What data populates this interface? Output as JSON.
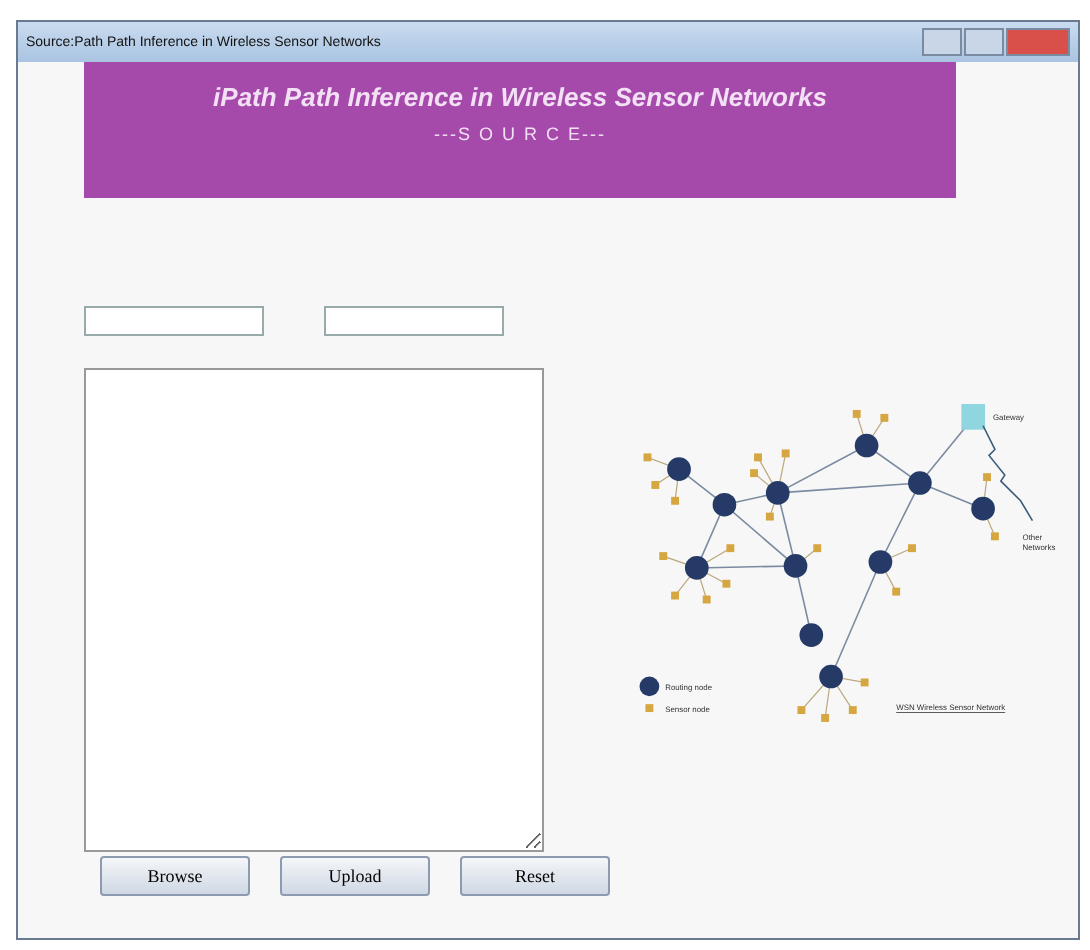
{
  "window": {
    "title": "Source:Path Path Inference in Wireless Sensor Networks"
  },
  "banner": {
    "title": "iPath Path Inference in Wireless Sensor Networks",
    "subtitle": "---S O U R C E---"
  },
  "diagram": {
    "gateway_label": "Gateway",
    "other_label": "Other Networks",
    "legend": [
      "Routing node",
      "Sensor node"
    ],
    "caption": "WSN Wireless Sensor Network"
  },
  "buttons": [
    "Browse",
    "Upload",
    "Reset"
  ]
}
